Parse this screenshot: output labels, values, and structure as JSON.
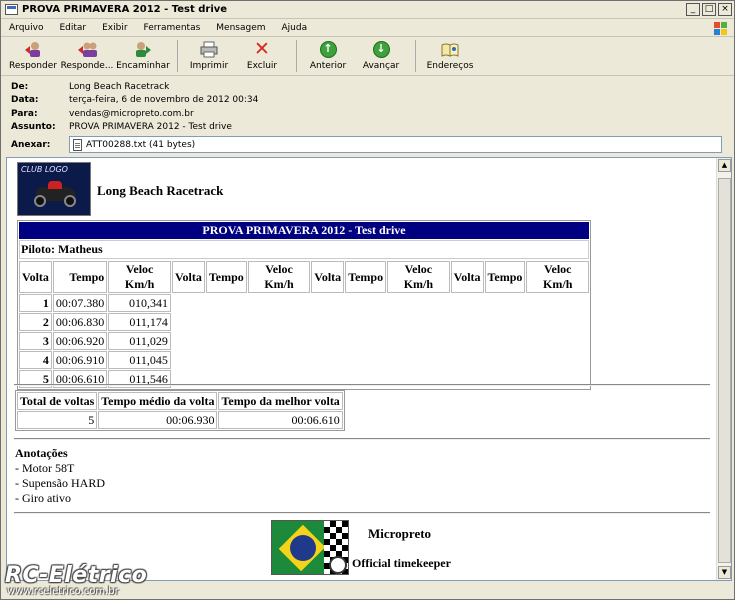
{
  "window": {
    "title": "PROVA PRIMAVERA 2012 - Test drive"
  },
  "menu": [
    "Arquivo",
    "Editar",
    "Exibir",
    "Ferramentas",
    "Mensagem",
    "Ajuda"
  ],
  "toolbar": {
    "reply": "Responder",
    "reply_all": "Responde...",
    "forward": "Encaminhar",
    "print": "Imprimir",
    "delete": "Excluir",
    "previous": "Anterior",
    "next": "Avançar",
    "addresses": "Endereços"
  },
  "header": {
    "from_label": "De:",
    "from": "Long Beach Racetrack",
    "date_label": "Data:",
    "date": "terça-feira, 6 de novembro de 2012 00:34",
    "to_label": "Para:",
    "to": "vendas@micropreto.com.br",
    "subject_label": "Assunto:",
    "subject": "PROVA PRIMAVERA 2012 - Test drive",
    "attach_label": "Anexar:",
    "attachment": "ATT00288.txt (41 bytes)"
  },
  "message": {
    "logo_text": "CLUB LOGO",
    "track": "Long Beach Racetrack",
    "event_title": "PROVA PRIMAVERA 2012 - Test drive",
    "pilot": "Piloto: Matheus",
    "columns": [
      "Volta",
      "Tempo",
      "Veloc Km/h",
      "Volta",
      "Tempo",
      "Veloc Km/h",
      "Volta",
      "Tempo",
      "Veloc Km/h",
      "Volta",
      "Tempo",
      "Veloc Km/h"
    ],
    "laps": [
      {
        "lap": "1",
        "time": "00:07.380",
        "speed": "010,341"
      },
      {
        "lap": "2",
        "time": "00:06.830",
        "speed": "011,174"
      },
      {
        "lap": "3",
        "time": "00:06.920",
        "speed": "011,029"
      },
      {
        "lap": "4",
        "time": "00:06.910",
        "speed": "011,045"
      },
      {
        "lap": "5",
        "time": "00:06.610",
        "speed": "011,546"
      }
    ],
    "summary": {
      "h_total": "Total de voltas",
      "h_avg": "Tempo médio da volta",
      "h_best": "Tempo da melhor volta",
      "total": "5",
      "avg": "00:06.930",
      "best": "00:06.610"
    },
    "notes_title": "Anotações",
    "notes": [
      "- Motor 58T",
      "- Supensão HARD",
      "- Giro ativo"
    ],
    "footer_title": "Micropreto",
    "footer_sub": "Official timekeeper"
  },
  "watermark": {
    "brand": "RC-Elétrico",
    "url": "www.rceletrico.com.br"
  }
}
